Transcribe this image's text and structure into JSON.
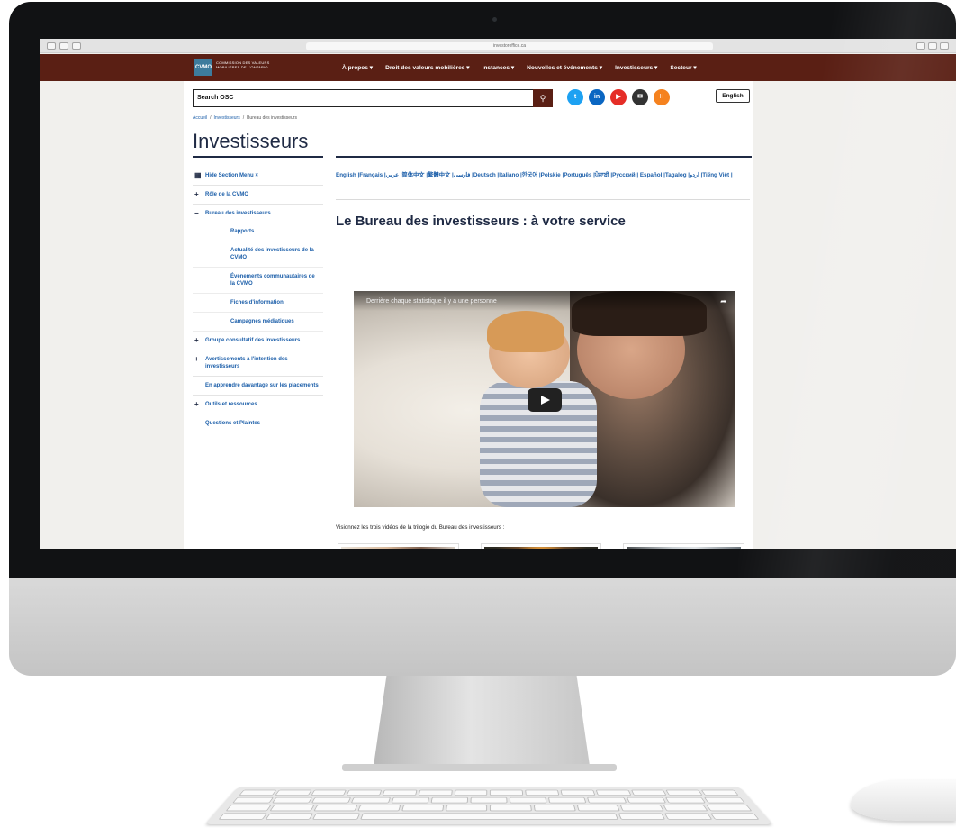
{
  "browser": {
    "url": "investoroffice.ca"
  },
  "site": {
    "logo_abbr": "CVMO",
    "logo_text": "COMMISSION DES VALEURS MOBILIÈRES DE L'ONTARIO",
    "menu": [
      {
        "label": "À propos ▾"
      },
      {
        "label": "Droit des valeurs mobilières ▾"
      },
      {
        "label": "Instances ▾"
      },
      {
        "label": "Nouvelles et événements ▾"
      },
      {
        "label": "Investisseurs ▾"
      },
      {
        "label": "Secteur ▾"
      }
    ],
    "search_placeholder": "Search OSC",
    "language_toggle": "English",
    "social_icons": [
      "twitter-icon",
      "linkedin-icon",
      "youtube-icon",
      "email-icon",
      "rss-icon"
    ]
  },
  "breadcrumb": {
    "items": [
      "Accueil",
      "Investisseurs",
      "Bureau des investisseurs"
    ],
    "separator": "/"
  },
  "page_title": "Investisseurs",
  "sidebar": {
    "hide_label": "Hide Section Menu ×",
    "items": [
      {
        "label": "Rôle de la CVMO",
        "sign": "+"
      },
      {
        "label": "Bureau des investisseurs",
        "sign": "−"
      }
    ],
    "sub_items": [
      {
        "label": "Rapports"
      },
      {
        "label": "Actualité des investisseurs de la CVMO"
      },
      {
        "label": "Événements communautaires de la CVMO"
      },
      {
        "label": "Fiches d'information"
      },
      {
        "label": "Campagnes médiatiques"
      }
    ],
    "more_items": [
      {
        "label": "Groupe consultatif des investisseurs",
        "sign": "+"
      },
      {
        "label": "Avertissements à l'intention des investisseurs",
        "sign": "+"
      },
      {
        "label": "En apprendre davantage sur les placements",
        "sign": ""
      },
      {
        "label": "Outils et ressources",
        "sign": "+"
      },
      {
        "label": "Questions et Plaintes",
        "sign": ""
      }
    ]
  },
  "languages": "English |Français |عربي |简体中文 |繁體中文 |فارسی |Deutsch |Italiano |한국어 |Polskie |Português |ਪੰਜਾਬੀ |Русский | Español |Tagalog |اردو |Tiếng Việt |",
  "main": {
    "heading": "Le Bureau des investisseurs : à votre service",
    "video_title": "Derrière chaque statistique il y a une personne",
    "caption": "Visionnez les trois vidéos de la trilogie du Bureau des investisseurs :"
  },
  "colors": {
    "nav_bg": "#5a1f14",
    "link": "#1b5ea9",
    "heading": "#1f2a44",
    "twitter": "#1da1f2",
    "linkedin": "#0a66c2",
    "youtube": "#e52d27",
    "email": "#333333",
    "rss": "#f5821f"
  }
}
